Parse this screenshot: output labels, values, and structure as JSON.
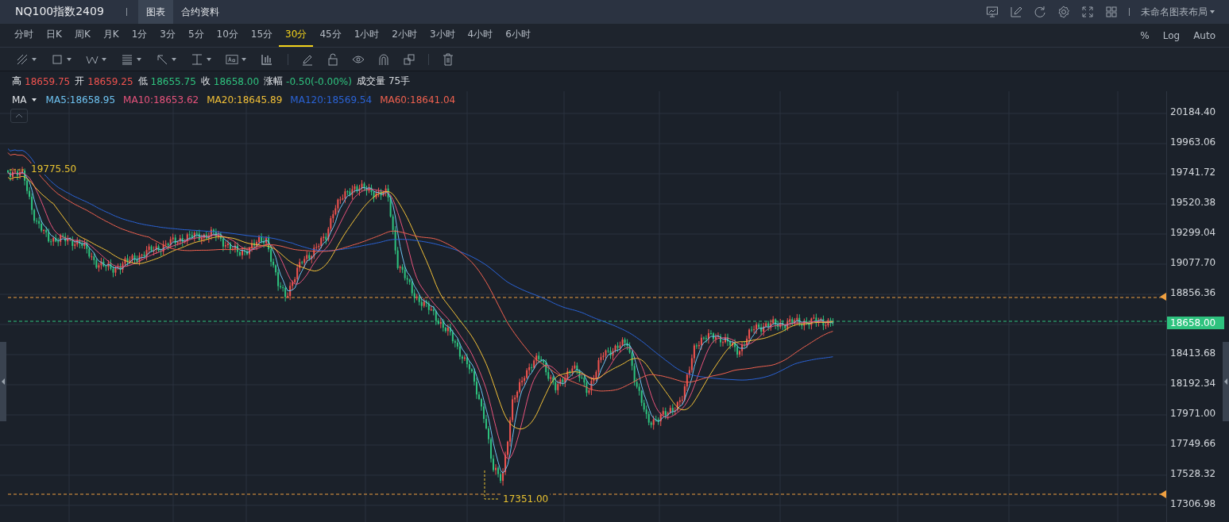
{
  "header": {
    "title": "NQ100指数2409",
    "tabs": [
      {
        "label": "图表",
        "selected": true
      },
      {
        "label": "合约资料",
        "selected": false
      }
    ],
    "layout_menu": "未命名图表布局"
  },
  "periods": [
    {
      "label": "分时",
      "selected": false
    },
    {
      "label": "日K",
      "selected": false
    },
    {
      "label": "周K",
      "selected": false
    },
    {
      "label": "月K",
      "selected": false
    },
    {
      "label": "1分",
      "selected": false
    },
    {
      "label": "3分",
      "selected": false
    },
    {
      "label": "5分",
      "selected": false
    },
    {
      "label": "10分",
      "selected": false
    },
    {
      "label": "15分",
      "selected": false
    },
    {
      "label": "30分",
      "selected": true
    },
    {
      "label": "45分",
      "selected": false
    },
    {
      "label": "1小时",
      "selected": false
    },
    {
      "label": "2小时",
      "selected": false
    },
    {
      "label": "3小时",
      "selected": false
    },
    {
      "label": "4小时",
      "selected": false
    },
    {
      "label": "6小时",
      "selected": false
    }
  ],
  "scale_options": [
    "%",
    "Log",
    "Auto"
  ],
  "quote": [
    {
      "label": "高",
      "value": "18659.75",
      "kind": "up"
    },
    {
      "label": "开",
      "value": "18659.25",
      "kind": "up"
    },
    {
      "label": "低",
      "value": "18655.75",
      "kind": "down"
    },
    {
      "label": "收",
      "value": "18658.00",
      "kind": "down"
    },
    {
      "label": "涨幅",
      "value": "-0.50(-0.00%)",
      "kind": "down"
    },
    {
      "label": "成交量",
      "value": "75手",
      "kind": "neutral"
    }
  ],
  "indicator": {
    "name": "MA",
    "lines": [
      {
        "label": "MA5:18658.95",
        "color": "#6ec3f2"
      },
      {
        "label": "MA10:18653.62",
        "color": "#e8537c"
      },
      {
        "label": "MA20:18645.89",
        "color": "#f2c037"
      },
      {
        "label": "MA120:18569.54",
        "color": "#2a63d6"
      },
      {
        "label": "MA60:18641.04",
        "color": "#f0614f"
      }
    ]
  },
  "price_axis": [
    {
      "label": "20184.40",
      "kind": "tick"
    },
    {
      "label": "19963.06",
      "kind": "tick"
    },
    {
      "label": "19741.72",
      "kind": "tick"
    },
    {
      "label": "19520.38",
      "kind": "tick"
    },
    {
      "label": "19299.04",
      "kind": "tick"
    },
    {
      "label": "19077.70",
      "kind": "tick"
    },
    {
      "label": "18856.36",
      "kind": "tick"
    },
    {
      "label": "18658.00",
      "kind": "last"
    },
    {
      "label": "18413.68",
      "kind": "tick"
    },
    {
      "label": "18192.34",
      "kind": "tick"
    },
    {
      "label": "17971.00",
      "kind": "tick"
    },
    {
      "label": "17749.66",
      "kind": "tick"
    },
    {
      "label": "17528.32",
      "kind": "tick"
    },
    {
      "label": "17306.98",
      "kind": "tick"
    }
  ],
  "high_mark": "19775.50",
  "low_mark": "17351.00"
}
